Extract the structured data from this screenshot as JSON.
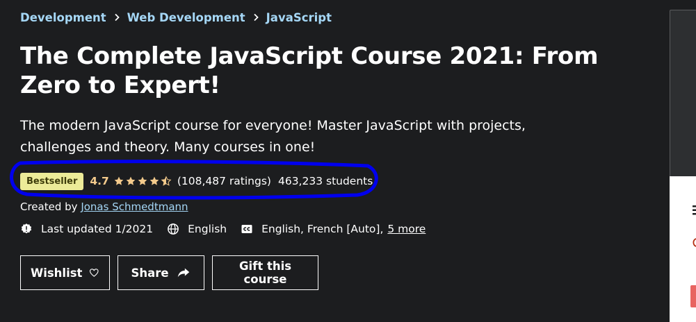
{
  "breadcrumb": {
    "items": [
      "Development",
      "Web Development",
      "JavaScript"
    ]
  },
  "course": {
    "title": "The Complete JavaScript Course 2021: From Zero to Expert!",
    "subtitle": "The modern JavaScript course for everyone! Master JavaScript with projects, challenges and theory. Many courses in one!",
    "badge": "Bestseller",
    "rating": "4.7",
    "stars_value": 4.5,
    "ratings_count": "(108,487 ratings)",
    "students": "463,233 students",
    "created_by_label": "Created by",
    "author": "Jonas Schmedtmann",
    "last_updated": "Last updated 1/2021",
    "language": "English",
    "captions": "English, French [Auto],",
    "captions_more": "5 more"
  },
  "actions": {
    "wishlist_label": "Wishlist",
    "share_label": "Share",
    "gift_label": "Gift this course"
  },
  "icons": {
    "breadcrumb_separator": "chevron-right-icon",
    "star": "star-icon",
    "last_updated": "alert-badge-icon",
    "language": "globe-icon",
    "captions": "closed-captions-icon",
    "wishlist": "heart-icon",
    "share": "share-arrow-icon"
  },
  "colors": {
    "background": "#1c1d1f",
    "link": "#a5d7f6",
    "badge_bg": "#eceb98",
    "badge_text": "#3d3c0a",
    "rating": "#f3ca8c",
    "highlight": "#0000ee",
    "side_red": "#e86461"
  }
}
